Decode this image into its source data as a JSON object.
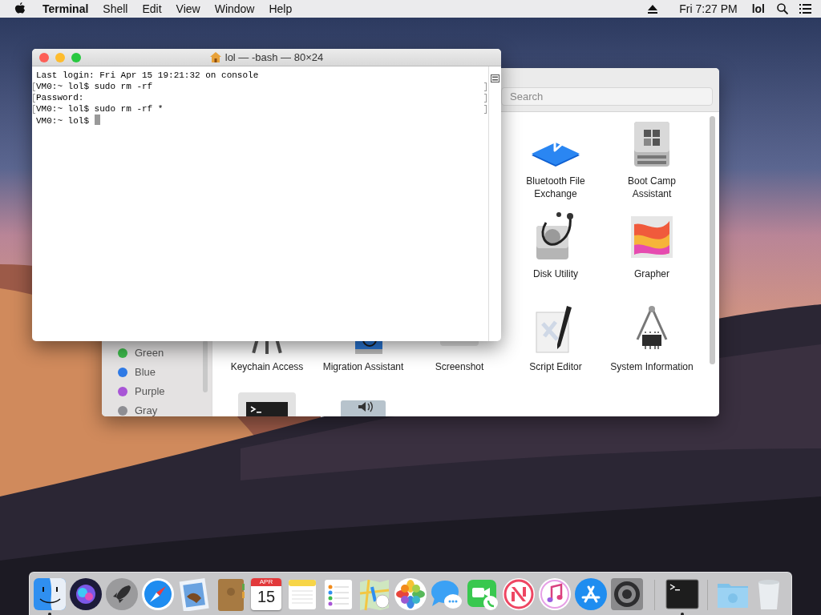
{
  "menu_bar": {
    "app_name": "Terminal",
    "menus": [
      "Shell",
      "Edit",
      "View",
      "Window",
      "Help"
    ],
    "clock": "Fri 7:27 PM",
    "user": "lol"
  },
  "terminal": {
    "title": "lol — -bash — 80×24",
    "lines": [
      {
        "text": "Last login: Fri Apr 15 19:21:32 on console",
        "marked": false,
        "cursor": false
      },
      {
        "text": "VM0:~ lol$ sudo rm -rf",
        "marked": true,
        "cursor": false
      },
      {
        "text": "Password:",
        "marked": true,
        "cursor": false
      },
      {
        "text": "VM0:~ lol$ sudo rm -rf *",
        "marked": true,
        "cursor": false
      },
      {
        "text": "VM0:~ lol$ ",
        "marked": false,
        "cursor": true
      }
    ]
  },
  "finder": {
    "search": {
      "placeholder": "Search"
    },
    "tags": [
      {
        "label": "Green",
        "color": "#3dbb4b"
      },
      {
        "label": "Blue",
        "color": "#2f7ae5"
      },
      {
        "label": "Purple",
        "color": "#a855d6"
      },
      {
        "label": "Gray",
        "color": "#8e8e93"
      }
    ],
    "apps": [
      {
        "name": "Bluetooth File Exchange"
      },
      {
        "name": "Boot Camp Assistant"
      },
      {
        "name": "Disk Utility"
      },
      {
        "name": "Grapher"
      },
      {
        "name": "Keychain Access"
      },
      {
        "name": "Migration Assistant"
      },
      {
        "name": "Screenshot"
      },
      {
        "name": "Script Editor"
      },
      {
        "name": "System Information"
      }
    ]
  },
  "dock": {
    "items": [
      {
        "running": true
      },
      {
        "running": false
      },
      {
        "running": false
      },
      {
        "running": false
      },
      {
        "running": false
      },
      {
        "running": false
      },
      {
        "running": false,
        "month": "APR",
        "day": "15"
      },
      {
        "running": false
      },
      {
        "running": false
      },
      {
        "running": false
      },
      {
        "running": false
      },
      {
        "running": false
      },
      {
        "running": false
      },
      {
        "running": false
      },
      {
        "running": false
      },
      {
        "running": false
      },
      {
        "running": false
      },
      {
        "running": true
      },
      {
        "running": false
      },
      {
        "running": false
      }
    ]
  }
}
